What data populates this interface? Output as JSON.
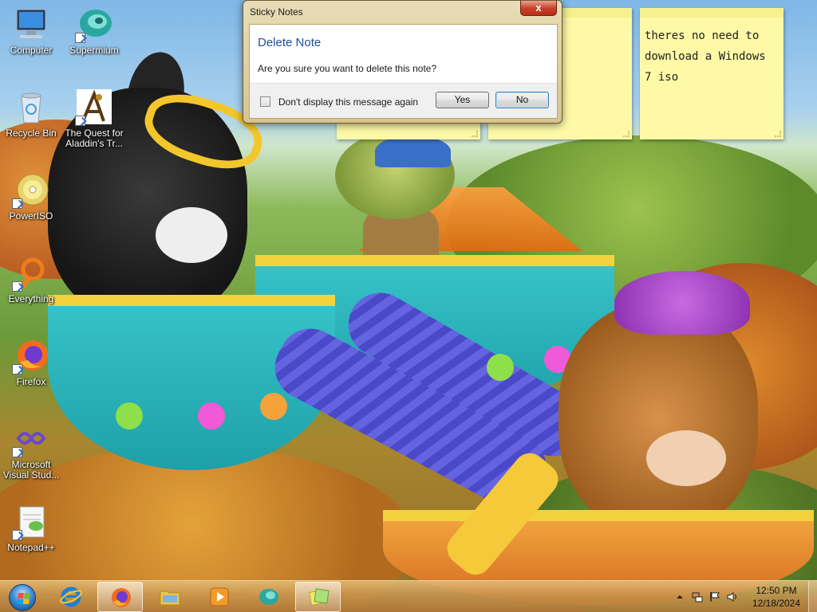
{
  "desktop": {
    "icons": [
      {
        "label": "Computer"
      },
      {
        "label": "Supermium"
      },
      {
        "label": "Recycle Bin"
      },
      {
        "label": "The Quest for Aladdin's Tr..."
      },
      {
        "label": "PowerISO"
      },
      {
        "label": "Everything"
      },
      {
        "label": "Firefox"
      },
      {
        "label": "Microsoft Visual Stud..."
      },
      {
        "label": "Notepad++"
      }
    ]
  },
  "sticky_notes": {
    "note3_text": "theres no need to\ndownload a Windows\n7 iso"
  },
  "dialog": {
    "window_title": "Sticky Notes",
    "close_label": "x",
    "heading": "Delete Note",
    "message": "Are you sure you want to delete this note?",
    "checkbox_label": "Don't display this message again",
    "checkbox_checked": false,
    "yes_label": "Yes",
    "no_label": "No"
  },
  "taskbar": {
    "pinned": [
      {
        "icon": "internet-explorer-icon"
      },
      {
        "icon": "firefox-icon"
      },
      {
        "icon": "file-explorer-icon"
      },
      {
        "icon": "media-player-icon"
      },
      {
        "icon": "supermium-icon"
      },
      {
        "icon": "sticky-notes-icon"
      }
    ],
    "clock": {
      "time": "12:50 PM",
      "date": "12/18/2024"
    }
  },
  "colors": {
    "accent": "#1d4f9a",
    "taskbar": "#c8965a",
    "sticky": "#fdf9a6"
  }
}
